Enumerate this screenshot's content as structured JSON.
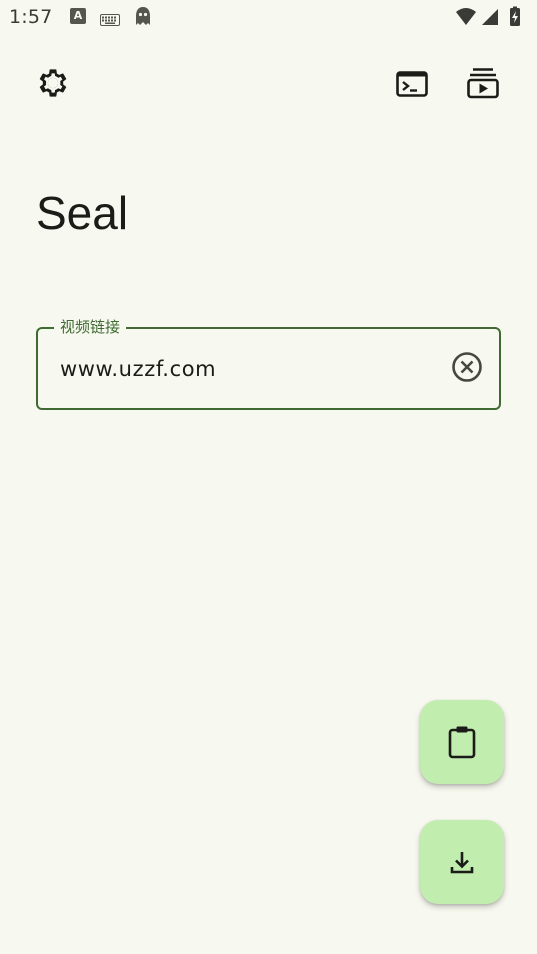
{
  "status_bar": {
    "time": "1:57",
    "notification_icons": [
      "app-a-icon",
      "keyboard-icon",
      "ghost-icon"
    ],
    "system_icons": [
      "wifi-icon",
      "cell-signal-icon",
      "battery-charging-icon"
    ]
  },
  "toolbar": {
    "left_icon": "settings-gear-icon",
    "right_icons": [
      "terminal-icon",
      "playlist-queue-icon"
    ]
  },
  "app": {
    "title": "Seal"
  },
  "url_field": {
    "label": "视频链接",
    "value": "www.uzzf.com",
    "trailing_icon": "clear-circle-icon"
  },
  "fabs": [
    {
      "icon": "clipboard-paste-icon"
    },
    {
      "icon": "download-icon"
    }
  ],
  "colors": {
    "background": "#f7f8ef",
    "primary": "#3f6b33",
    "fab_container": "#c1edae",
    "on_surface": "#1b1c18"
  }
}
